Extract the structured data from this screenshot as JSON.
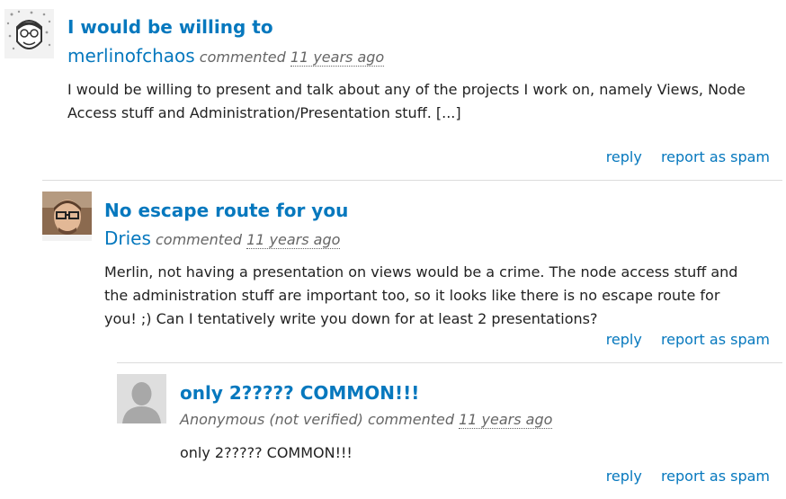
{
  "comments": [
    {
      "title": "I would be willing to",
      "author": "merlinofchaos",
      "verb": "commented",
      "time": "11 years ago",
      "body": "I would be willing to present and talk about any of the projects I work on, namely Views, Node Access stuff and Administration/Presentation stuff. [...]",
      "reply": "reply",
      "spam": "report as spam"
    },
    {
      "title": "No escape route for you",
      "author": "Dries",
      "verb": "commented",
      "time": "11 years ago",
      "body": "Merlin, not having a presentation on views would be a crime. The node access stuff and the administration stuff are important too, so it looks like there is no escape route for you! ;) Can I tentatively write you down for at least 2 presentations?",
      "reply": "reply",
      "spam": "report as spam"
    },
    {
      "title": "only 2????? COMMON!!!",
      "author": "Anonymous (not verified)",
      "verb": "commented",
      "time": "11 years ago",
      "body": "only 2????? COMMON!!!",
      "reply": "reply",
      "spam": "report as spam"
    }
  ],
  "colors": {
    "link": "#0678be",
    "meta": "#666666",
    "separator": "#dcdcdc"
  }
}
